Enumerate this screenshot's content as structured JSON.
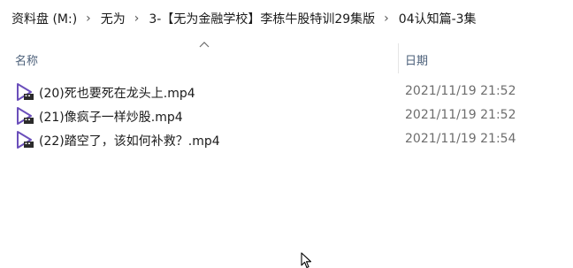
{
  "breadcrumb": {
    "items": [
      {
        "label": "资料盘 (M:)"
      },
      {
        "label": "无为"
      },
      {
        "label": "3-【无为金融学校】李栋牛股特训29集版"
      },
      {
        "label": "04认知篇-3集"
      }
    ],
    "separator": "›"
  },
  "columns": {
    "name_label": "名称",
    "date_label": "日期",
    "sort": "ascending"
  },
  "files": [
    {
      "name": "(20)死也要死在龙头上.mp4",
      "date": "2021/11/19 21:52",
      "icon": "video-file-icon"
    },
    {
      "name": "(21)像疯子一样炒股.mp4",
      "date": "2021/11/19 21:52",
      "icon": "video-file-icon"
    },
    {
      "name": "(22)踏空了，该如何补救？.mp4",
      "date": "2021/11/19 21:54",
      "icon": "video-file-icon"
    }
  ],
  "colors": {
    "header_text": "#4c607a",
    "date_text": "#6d6d6d",
    "icon_purple": "#6b4fbb"
  }
}
